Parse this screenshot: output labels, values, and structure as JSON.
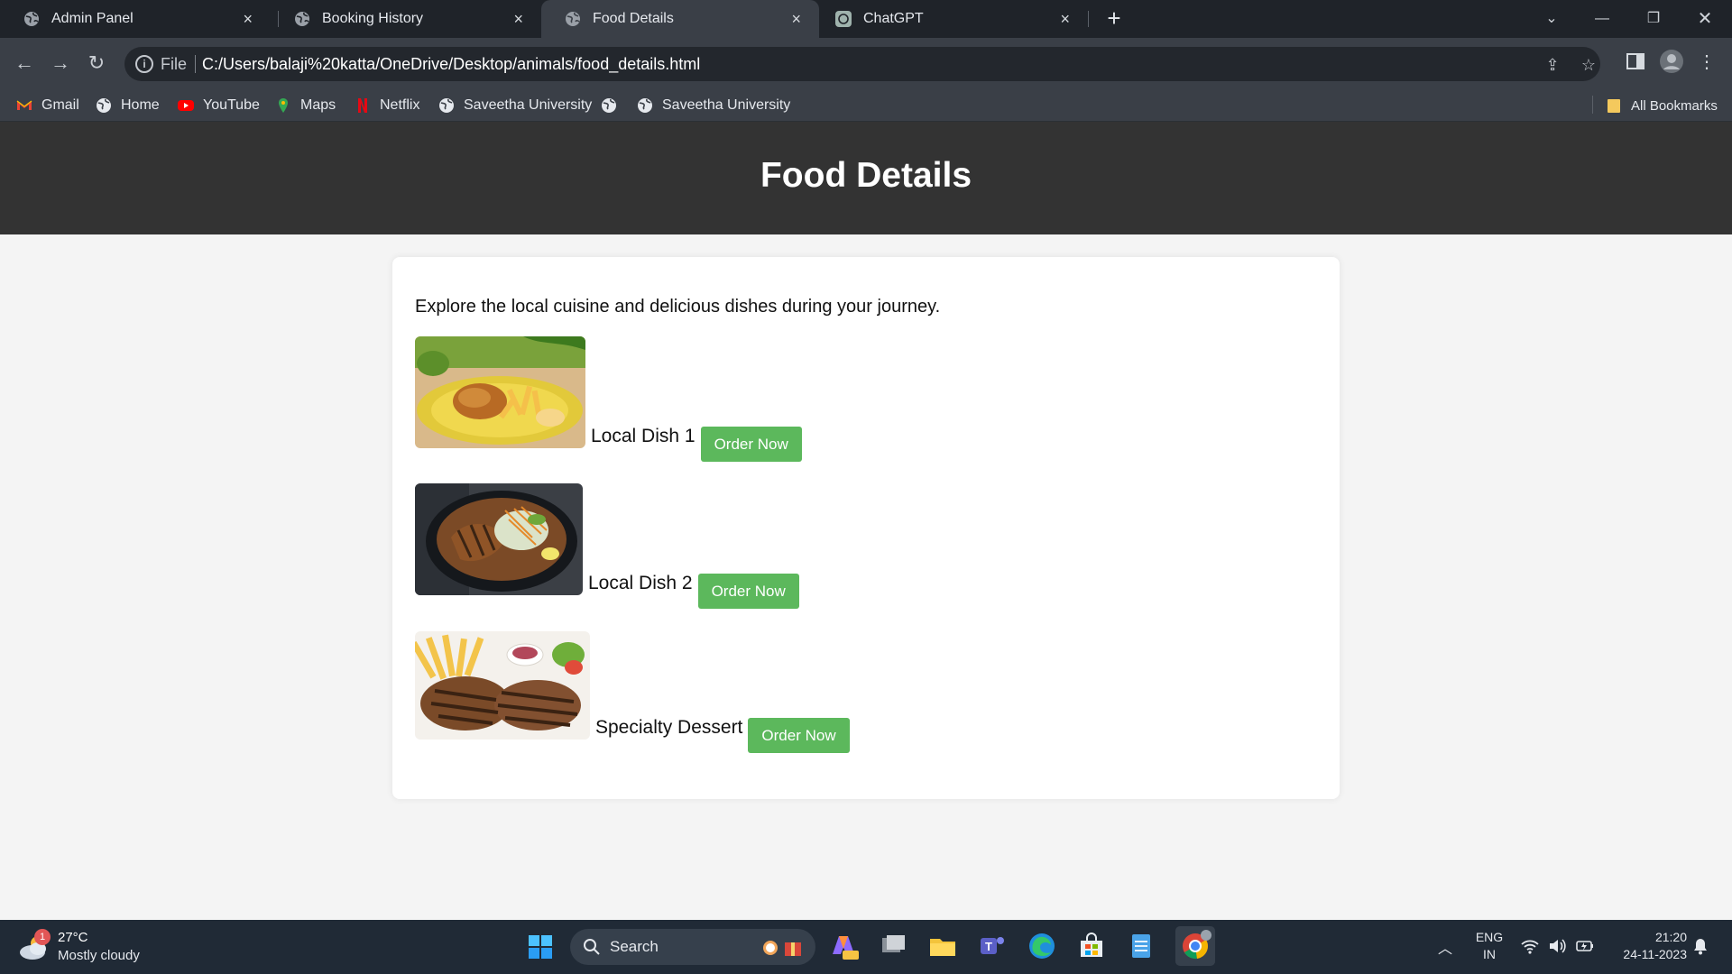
{
  "browser": {
    "tabs": [
      {
        "title": "Admin Panel",
        "favicon": "globe-icon",
        "active": false
      },
      {
        "title": "Booking History",
        "favicon": "globe-icon",
        "active": false
      },
      {
        "title": "Food Details",
        "favicon": "globe-icon",
        "active": true
      },
      {
        "title": "ChatGPT",
        "favicon": "chatgpt-icon",
        "active": false
      }
    ],
    "close_glyph": "×",
    "new_tab_glyph": "+",
    "omnibox": {
      "scheme_label": "File",
      "url": "C:/Users/balaji%20katta/OneDrive/Desktop/animals/food_details.html"
    },
    "bookmarks": [
      {
        "label": "Gmail",
        "icon": "gmail-icon"
      },
      {
        "label": "Home",
        "icon": "globe-icon"
      },
      {
        "label": "YouTube",
        "icon": "youtube-icon"
      },
      {
        "label": "Maps",
        "icon": "maps-icon"
      },
      {
        "label": "Netflix",
        "icon": "netflix-icon"
      },
      {
        "label": "Saveetha University",
        "icon": "globe-icon"
      },
      {
        "label": "",
        "icon": "globe-icon"
      },
      {
        "label": "Saveetha University",
        "icon": "globe-icon"
      }
    ],
    "all_bookmarks_label": "All Bookmarks"
  },
  "page": {
    "title": "Food Details",
    "intro": "Explore the local cuisine and delicious dishes during your journey.",
    "dishes": [
      {
        "name": "Local Dish 1",
        "button": "Order Now",
        "image": "fried-chicken-fries-plate"
      },
      {
        "name": "Local Dish 2",
        "button": "Order Now",
        "image": "grilled-meat-salad-bowl"
      },
      {
        "name": "Specialty Dessert",
        "button": "Order Now",
        "image": "grilled-patties-fries"
      }
    ]
  },
  "taskbar": {
    "weather": {
      "badge": "1",
      "temp": "27°C",
      "condition": "Mostly cloudy"
    },
    "search_label": "Search",
    "language": {
      "line1": "ENG",
      "line2": "IN"
    },
    "clock": {
      "time": "21:20",
      "date": "24-11-2023"
    }
  },
  "colors": {
    "header_bg": "#333333",
    "button_green": "#5cb85c",
    "page_bg": "#f4f4f4",
    "browser_dark": "#1f2329",
    "browser_toolbar": "#3a3f47",
    "taskbar": "#202a36"
  }
}
